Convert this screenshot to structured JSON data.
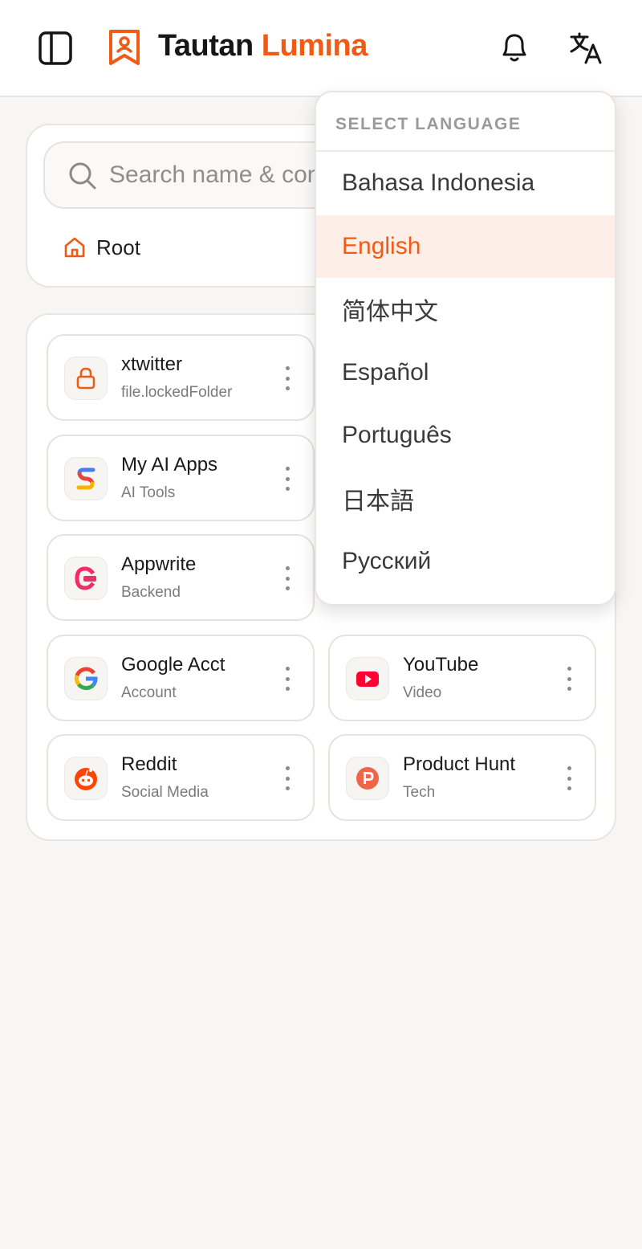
{
  "header": {
    "brand_part1": "Tautan",
    "brand_part2": "Lumina",
    "accent_color": "#ef5a14",
    "icons": [
      "sidebar-toggle-icon",
      "bookmark-logo-icon",
      "bell-icon",
      "translate-icon"
    ]
  },
  "search": {
    "placeholder": "Search name & content"
  },
  "breadcrumb": {
    "root_label": "Root",
    "icon": "home-icon"
  },
  "cards": [
    {
      "name": "xtwitter",
      "subtitle": "file.lockedFolder",
      "icon": "lock-icon"
    },
    {
      "name": "My AI Apps",
      "subtitle": "AI Tools",
      "icon": "gemini-colorful-icon"
    },
    {
      "name": "Appwrite",
      "subtitle": "Backend",
      "icon": "appwrite-icon"
    },
    {
      "name": "Google Acct",
      "subtitle": "Account",
      "icon": "google-g-icon"
    },
    {
      "name": "YouTube",
      "subtitle": "Video",
      "icon": "youtube-icon"
    },
    {
      "name": "Reddit",
      "subtitle": "Social Media",
      "icon": "reddit-icon"
    },
    {
      "name": "Product Hunt",
      "subtitle": "Tech",
      "icon": "product-hunt-icon"
    }
  ],
  "language_menu": {
    "title": "SELECT LANGUAGE",
    "selected": "English",
    "options": [
      "Bahasa Indonesia",
      "English",
      "简体中文",
      "Español",
      "Português",
      "日本語",
      "Русский"
    ]
  }
}
